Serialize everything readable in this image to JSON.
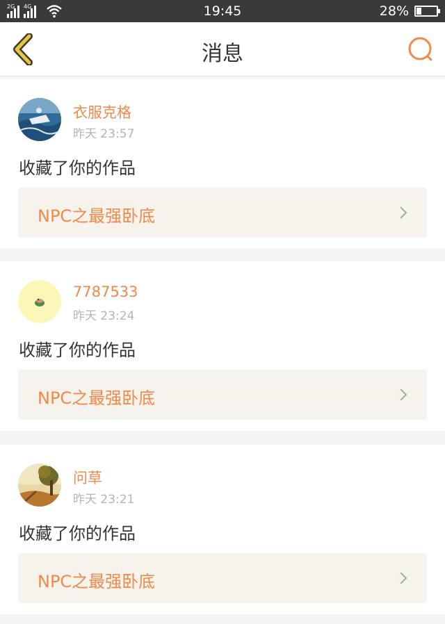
{
  "status_bar": {
    "network_1": "2G",
    "network_2": "4G",
    "time": "19:45",
    "battery_percent": "28%",
    "battery_level": 0.28
  },
  "header": {
    "title": "消息",
    "back_icon": "chevron-left-icon",
    "search_icon": "search-icon"
  },
  "colors": {
    "accent": "#f0894a",
    "back_icon": "#e8c53a",
    "card_link_bg": "#f5f3eb",
    "status_bar": "#3a3a3a"
  },
  "notifications": [
    {
      "username": "衣服克格",
      "time": "昨天 23:57",
      "action": "收藏了你的作品",
      "work_title": "NPC之最强卧底",
      "avatar": "ocean-avatar"
    },
    {
      "username": "7787533",
      "time": "昨天 23:24",
      "action": "收藏了你的作品",
      "work_title": "NPC之最强卧底",
      "avatar": "yellow-avatar"
    },
    {
      "username": "问草",
      "time": "昨天 23:21",
      "action": "收藏了你的作品",
      "work_title": "NPC之最强卧底",
      "avatar": "autumn-avatar"
    }
  ]
}
